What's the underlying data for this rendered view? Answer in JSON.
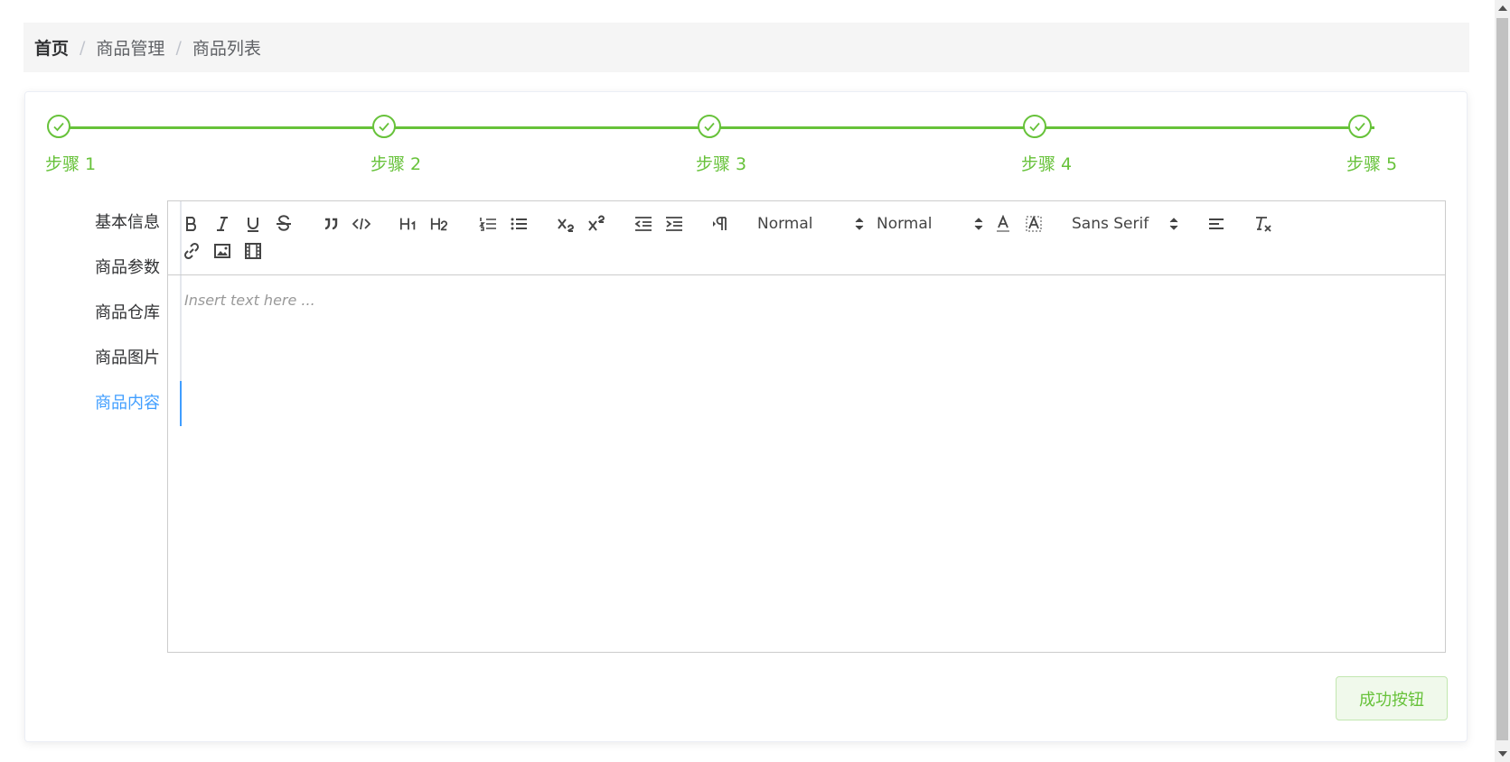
{
  "breadcrumb": {
    "items": [
      "首页",
      "商品管理",
      "商品列表"
    ],
    "separator": "/"
  },
  "steps": {
    "items": [
      "步骤 1",
      "步骤 2",
      "步骤 3",
      "步骤 4",
      "步骤 5"
    ],
    "color": "#67c23a",
    "status": "finished"
  },
  "tabs": {
    "items": [
      "基本信息",
      "商品参数",
      "商品仓库",
      "商品图片",
      "商品内容"
    ],
    "active_index": 4,
    "active_color": "#409eff"
  },
  "editor": {
    "header_picker": "Normal",
    "size_picker": "Normal",
    "font_picker": "Sans Serif",
    "placeholder": "Insert text here ...",
    "tools": [
      "bold-icon",
      "italic-icon",
      "underline-icon",
      "strike-icon",
      "blockquote-icon",
      "code-block-icon",
      "h1-icon",
      "h2-icon",
      "ordered-list-icon",
      "bullet-list-icon",
      "subscript-icon",
      "superscript-icon",
      "outdent-icon",
      "indent-icon",
      "rtl-direction-icon",
      "font-color-icon",
      "background-color-icon",
      "align-icon",
      "clean-format-icon",
      "link-icon",
      "image-icon",
      "video-icon"
    ]
  },
  "actions": {
    "success_label": "成功按钮"
  }
}
